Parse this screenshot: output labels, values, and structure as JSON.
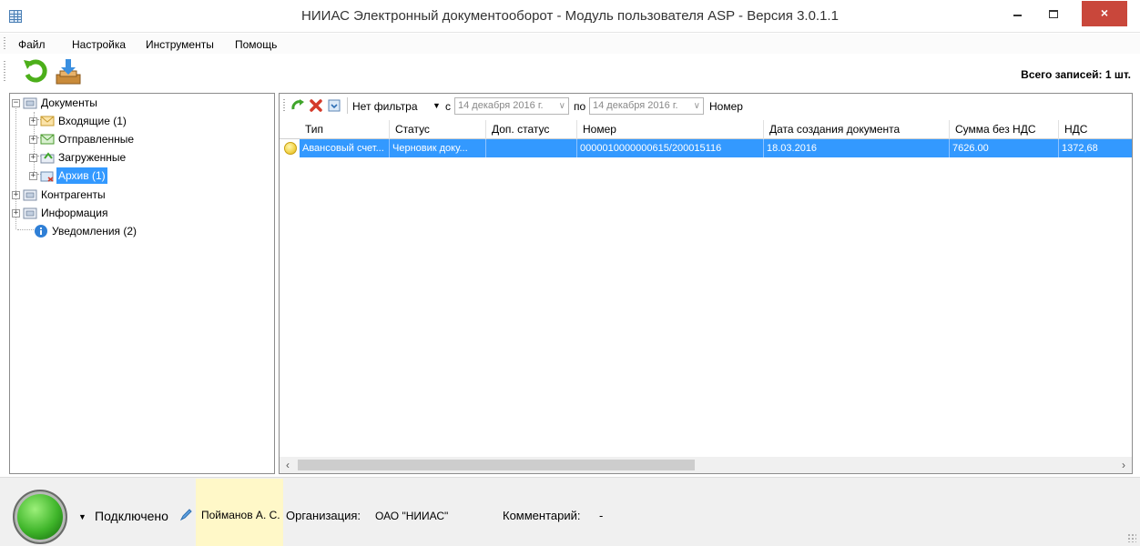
{
  "window": {
    "title": "НИИАС Электронный документооборот - Модуль пользователя ASP - Версия 3.0.1.1",
    "close_glyph": "×"
  },
  "menu": {
    "items": [
      "Файл",
      "Настройка",
      "Инструменты",
      "Помощь"
    ]
  },
  "toolbar": {
    "refresh_icon": "refresh-icon",
    "download_icon": "download-icon",
    "total_label": "Всего записей: 1 шт."
  },
  "tree": {
    "items": [
      {
        "label": "Документы",
        "icon": "folder-icon",
        "expander": "−"
      },
      {
        "label": "Входящие (1)",
        "icon": "envelope-icon",
        "expander": "+"
      },
      {
        "label": "Отправленные",
        "icon": "envelope-sent-icon",
        "expander": "+"
      },
      {
        "label": "Загруженные",
        "icon": "upload-icon",
        "expander": "+"
      },
      {
        "label": "Архив (1)",
        "icon": "archive-icon",
        "expander": "+"
      },
      {
        "label": "Контрагенты",
        "icon": "folder-icon",
        "expander": "+"
      },
      {
        "label": "Информация",
        "icon": "folder-icon",
        "expander": "+"
      },
      {
        "label": "Уведомления (2)",
        "icon": "info-icon"
      }
    ],
    "selected_index": 4
  },
  "filter_bar": {
    "filter_label": "Нет фильтра",
    "from_label": "с",
    "from_date": "14 декабря 2016 г.",
    "to_label": "по",
    "to_date": "14 декабря 2016 г.",
    "number_label": "Номер"
  },
  "grid": {
    "columns": [
      "Тип",
      "Статус",
      "Доп. статус",
      "Номер",
      "Дата создания документа",
      "Сумма без НДС",
      "НДС"
    ],
    "rows": [
      {
        "type": "Авансовый счет...",
        "status": "Черновик доку...",
        "extra_status": "",
        "number": "0000010000000615/200015116",
        "created": "18.03.2016",
        "sum": "7626.00",
        "vat": "1372,68"
      }
    ]
  },
  "status": {
    "connection": "Подключено",
    "user": "Пойманов А. С.",
    "organization_label": "Организация:",
    "organization": "ОАО \"НИИАС\"",
    "comment_label": "Комментарий:",
    "comment": "-"
  },
  "colors": {
    "selection": "#3399ff",
    "close_button": "#c9473b",
    "user_highlight": "#fff8c8",
    "connection_ok": "#3fb52a"
  }
}
